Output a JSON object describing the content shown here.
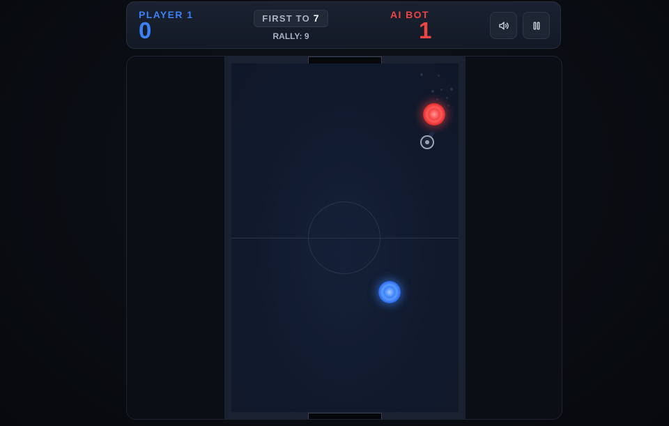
{
  "scoreboard": {
    "player1": {
      "label": "PLAYER 1",
      "score": "0",
      "color": "#3b82f6"
    },
    "ai": {
      "label": "AI BOT",
      "score": "1",
      "color": "#ef4444"
    },
    "match": {
      "first_to_label": "FIRST TO",
      "first_to_value": "7",
      "rally": "RALLY: 9"
    },
    "controls": [
      {
        "name": "sound",
        "icon": "speaker-icon"
      },
      {
        "name": "pause",
        "icon": "pause-icon"
      }
    ]
  },
  "field": {
    "colors": {
      "surface": "#111a2d",
      "rim": "#1a2232",
      "lines": "#2a3448",
      "player_paddle": "#3b82f6",
      "ai_paddle": "#ef4444",
      "puck": "#9aa4b4"
    }
  }
}
